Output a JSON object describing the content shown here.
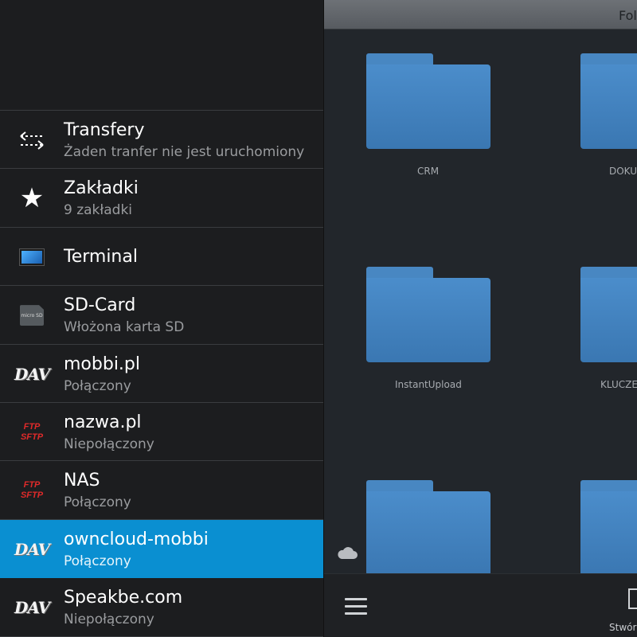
{
  "drawer": {
    "items": [
      {
        "title": "Transfery",
        "subtitle": "Żaden tranfer nie jest uruchomiony",
        "icon": "transfer-arrows-icon"
      },
      {
        "title": "Zakładki",
        "subtitle": "9 zakładki",
        "icon": "star-icon"
      },
      {
        "title": "Terminal",
        "subtitle": "",
        "icon": "terminal-icon"
      },
      {
        "title": "SD-Card",
        "subtitle": "Włożona karta SD",
        "icon": "sd-card-icon"
      },
      {
        "title": "mobbi.pl",
        "subtitle": "Połączony",
        "icon": "dav-icon"
      },
      {
        "title": "nazwa.pl",
        "subtitle": "Niepołączony",
        "icon": "ftp-sftp-icon"
      },
      {
        "title": "NAS",
        "subtitle": "Połączony",
        "icon": "ftp-sftp-icon"
      },
      {
        "title": "owncloud-mobbi",
        "subtitle": "Połączony",
        "icon": "dav-icon",
        "active": true
      },
      {
        "title": "Speakbe.com",
        "subtitle": "Niepołączony",
        "icon": "dav-icon"
      }
    ],
    "icon_text": {
      "dav": "DAV",
      "ftp": "FTP",
      "sftp": "SFTP",
      "sd": "micro SD"
    }
  },
  "browser": {
    "title": "Fol",
    "folders": [
      "CRM",
      "DOKU",
      "InstantUpload",
      "KLUCZE",
      "",
      ""
    ],
    "footer": {
      "create_label": "Stwór"
    }
  },
  "colors": {
    "accent": "#0a8fd1",
    "folder": "#4887c2",
    "ftp_red": "#e02a2a"
  }
}
